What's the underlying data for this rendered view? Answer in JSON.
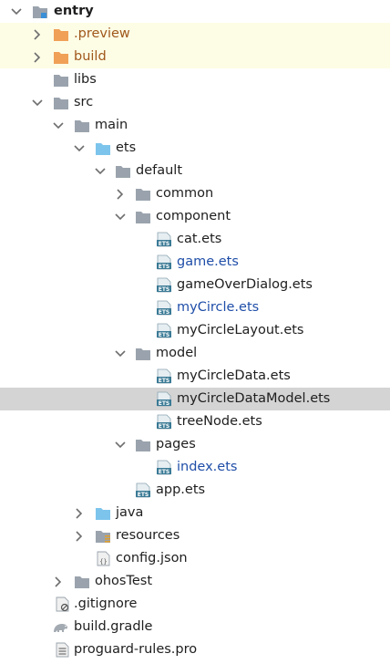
{
  "colors": {
    "folder_gray": "#9aa3ad",
    "folder_blue": "#7cc4ec",
    "folder_orange": "#f0a057",
    "ets_icon": "#3a7a95",
    "modified_text": "#1f4ea8",
    "selected_row": "#d4d4d4",
    "excluded_row": "#fdfde6"
  },
  "tree": [
    {
      "label": "entry",
      "icon": "module-folder-icon",
      "expanded": true
    },
    {
      "label": ".preview",
      "icon": "folder-orange-icon",
      "expanded": false
    },
    {
      "label": "build",
      "icon": "folder-orange-icon",
      "expanded": false
    },
    {
      "label": "libs",
      "icon": "folder-icon"
    },
    {
      "label": "src",
      "icon": "folder-icon",
      "expanded": true
    },
    {
      "label": "main",
      "icon": "folder-icon",
      "expanded": true
    },
    {
      "label": "ets",
      "icon": "folder-blue-icon",
      "expanded": true
    },
    {
      "label": "default",
      "icon": "folder-icon",
      "expanded": true
    },
    {
      "label": "common",
      "icon": "folder-icon",
      "expanded": false
    },
    {
      "label": "component",
      "icon": "folder-icon",
      "expanded": true
    },
    {
      "label": "cat.ets",
      "icon": "ets-file-icon"
    },
    {
      "label": "game.ets",
      "icon": "ets-file-icon",
      "modified": true
    },
    {
      "label": "gameOverDialog.ets",
      "icon": "ets-file-icon"
    },
    {
      "label": "myCircle.ets",
      "icon": "ets-file-icon",
      "modified": true
    },
    {
      "label": "myCircleLayout.ets",
      "icon": "ets-file-icon"
    },
    {
      "label": "model",
      "icon": "folder-icon",
      "expanded": true
    },
    {
      "label": "myCircleData.ets",
      "icon": "ets-file-icon"
    },
    {
      "label": "myCircleDataModel.ets",
      "icon": "ets-file-icon",
      "selected": true
    },
    {
      "label": "treeNode.ets",
      "icon": "ets-file-icon"
    },
    {
      "label": "pages",
      "icon": "folder-icon",
      "expanded": true
    },
    {
      "label": "index.ets",
      "icon": "ets-file-icon",
      "modified": true
    },
    {
      "label": "app.ets",
      "icon": "ets-file-icon"
    },
    {
      "label": "java",
      "icon": "folder-blue-icon",
      "expanded": false
    },
    {
      "label": "resources",
      "icon": "resources-folder-icon",
      "expanded": false
    },
    {
      "label": "config.json",
      "icon": "json-file-icon"
    },
    {
      "label": "ohosTest",
      "icon": "folder-icon",
      "expanded": false
    },
    {
      "label": ".gitignore",
      "icon": "gitignore-file-icon"
    },
    {
      "label": "build.gradle",
      "icon": "gradle-file-icon"
    },
    {
      "label": "proguard-rules.pro",
      "icon": "text-file-icon"
    }
  ]
}
